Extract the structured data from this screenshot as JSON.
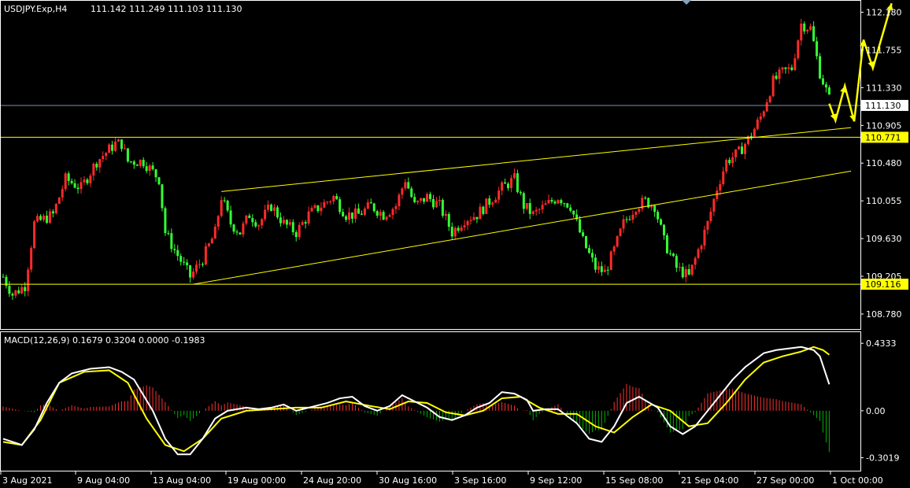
{
  "colors": {
    "background": "#000000",
    "foreground": "#ffffff",
    "bull_candle": "#ff2a2a",
    "bear_candle": "#33ff33",
    "level_line": "#ffff00",
    "price_line": "#7f8fb0",
    "macd_line": "#ffffff",
    "signal_line": "#ffff00",
    "hist_positive": "#ff3030",
    "hist_negative": "#00b000",
    "forecast_arrow": "#ffff00"
  },
  "header": {
    "symbol": "USDJPY.Exp,H4",
    "ohlc": "111.142 111.249 111.103 111.130",
    "collapse_icon": "triangle-down-icon"
  },
  "macd_header": {
    "text": "MACD(12,26,9) 0.1679 0.3204 0.0000 -0.1983"
  },
  "chart_data": [
    {
      "type": "candlestick",
      "title": "USDJPY.Exp,H4",
      "ylim": [
        108.62,
        112.3
      ],
      "yticks": [
        "112.180",
        "111.755",
        "111.330",
        "110.905",
        "110.480",
        "110.055",
        "109.630",
        "109.205",
        "108.780"
      ],
      "price_label": "111.130",
      "current_price": 111.13,
      "horizontal_levels": [
        {
          "value": 110.771,
          "label": "110.771"
        },
        {
          "value": 109.116,
          "label": "109.116"
        }
      ],
      "channel": {
        "upper": {
          "from_bar": 70,
          "from": 110.16,
          "to_bar": 272,
          "to": 110.88
        },
        "lower": {
          "from_bar": 61,
          "from": 109.115,
          "to_bar": 272,
          "to": 110.39
        }
      },
      "xticks": [
        "3 Aug 2021",
        "9 Aug 04:00",
        "13 Aug 04:00",
        "19 Aug 00:00",
        "24 Aug 20:00",
        "30 Aug 16:00",
        "3 Sep 16:00",
        "9 Sep 12:00",
        "15 Sep 08:00",
        "21 Sep 04:00",
        "27 Sep 00:00",
        "1 Oct 00:00"
      ],
      "close_path": [
        [
          0,
          109.2
        ],
        [
          3,
          109.0
        ],
        [
          7,
          109.1
        ],
        [
          10,
          109.8
        ],
        [
          16,
          109.9
        ],
        [
          20,
          110.3
        ],
        [
          25,
          110.2
        ],
        [
          30,
          110.5
        ],
        [
          36,
          110.7
        ],
        [
          38,
          110.7
        ],
        [
          40,
          110.5
        ],
        [
          45,
          110.5
        ],
        [
          50,
          110.3
        ],
        [
          52,
          109.7
        ],
        [
          55,
          109.5
        ],
        [
          60,
          109.2
        ],
        [
          64,
          109.4
        ],
        [
          68,
          109.7
        ],
        [
          70,
          110.1
        ],
        [
          73,
          109.8
        ],
        [
          76,
          109.7
        ],
        [
          79,
          109.9
        ],
        [
          82,
          109.8
        ],
        [
          86,
          110.0
        ],
        [
          90,
          109.8
        ],
        [
          94,
          109.7
        ],
        [
          98,
          109.9
        ],
        [
          102,
          110.0
        ],
        [
          106,
          110.1
        ],
        [
          110,
          109.9
        ],
        [
          114,
          109.9
        ],
        [
          118,
          110.0
        ],
        [
          122,
          109.9
        ],
        [
          126,
          110.0
        ],
        [
          129,
          110.3
        ],
        [
          132,
          110.0
        ],
        [
          136,
          110.1
        ],
        [
          140,
          110.0
        ],
        [
          144,
          109.7
        ],
        [
          148,
          109.85
        ],
        [
          152,
          109.9
        ],
        [
          156,
          110.05
        ],
        [
          160,
          110.2
        ],
        [
          164,
          110.3
        ],
        [
          167,
          110.0
        ],
        [
          170,
          109.9
        ],
        [
          174,
          110.0
        ],
        [
          178,
          110.1
        ],
        [
          182,
          110.0
        ],
        [
          186,
          109.6
        ],
        [
          190,
          109.3
        ],
        [
          193,
          109.25
        ],
        [
          196,
          109.5
        ],
        [
          199,
          109.8
        ],
        [
          203,
          110.0
        ],
        [
          206,
          110.05
        ],
        [
          209,
          110.0
        ],
        [
          212,
          109.6
        ],
        [
          216,
          109.3
        ],
        [
          220,
          109.2
        ],
        [
          223,
          109.5
        ],
        [
          226,
          109.8
        ],
        [
          229,
          110.2
        ],
        [
          232,
          110.5
        ],
        [
          236,
          110.6
        ],
        [
          240,
          110.8
        ],
        [
          243,
          111.0
        ],
        [
          247,
          111.4
        ],
        [
          250,
          111.5
        ],
        [
          253,
          111.55
        ],
        [
          256,
          112.05
        ],
        [
          259,
          112.0
        ],
        [
          262,
          111.5
        ],
        [
          265,
          111.2
        ]
      ],
      "forecast_arrow": [
        [
          265,
          111.15
        ],
        [
          267,
          110.96
        ],
        [
          270,
          111.35
        ],
        [
          273,
          110.95
        ],
        [
          276,
          111.87
        ],
        [
          279,
          111.55
        ],
        [
          285,
          112.28
        ]
      ]
    },
    {
      "type": "line",
      "title": "MACD(12,26,9)",
      "ylim": [
        -0.38,
        0.5
      ],
      "yticks": [
        "0.4333",
        "0.00",
        "-0.3019"
      ],
      "series": [
        {
          "name": "MACD",
          "x": [
            0,
            6,
            10,
            14,
            18,
            22,
            28,
            34,
            38,
            42,
            48,
            52,
            56,
            60,
            64,
            68,
            72,
            78,
            82,
            86,
            90,
            94,
            100,
            104,
            108,
            112,
            116,
            120,
            124,
            128,
            132,
            136,
            140,
            144,
            148,
            152,
            156,
            160,
            164,
            168,
            170,
            174,
            178,
            184,
            188,
            192,
            196,
            200,
            204,
            210,
            214,
            218,
            222,
            226,
            230,
            234,
            238,
            244,
            248,
            252,
            256,
            260,
            262,
            265
          ],
          "values": [
            -0.18,
            -0.22,
            -0.12,
            0.05,
            0.18,
            0.24,
            0.27,
            0.28,
            0.25,
            0.2,
            0.0,
            -0.18,
            -0.28,
            -0.28,
            -0.18,
            -0.05,
            0.0,
            0.02,
            0.01,
            0.02,
            0.04,
            0.0,
            0.03,
            0.05,
            0.08,
            0.09,
            0.03,
            0.0,
            0.03,
            0.1,
            0.06,
            0.02,
            -0.04,
            -0.06,
            -0.03,
            0.02,
            0.05,
            0.12,
            0.11,
            0.07,
            0.0,
            0.01,
            0.01,
            -0.08,
            -0.18,
            -0.2,
            -0.1,
            0.05,
            0.09,
            0.02,
            -0.1,
            -0.15,
            -0.1,
            0.0,
            0.1,
            0.2,
            0.28,
            0.37,
            0.39,
            0.4,
            0.41,
            0.39,
            0.35,
            0.17
          ]
        },
        {
          "name": "Signal",
          "x": [
            0,
            6,
            12,
            18,
            26,
            34,
            40,
            46,
            52,
            58,
            64,
            70,
            78,
            86,
            94,
            102,
            110,
            118,
            124,
            130,
            136,
            142,
            148,
            154,
            160,
            166,
            172,
            178,
            184,
            190,
            196,
            202,
            208,
            214,
            220,
            226,
            232,
            238,
            244,
            250,
            256,
            260,
            263,
            265
          ],
          "values": [
            -0.2,
            -0.22,
            -0.06,
            0.18,
            0.25,
            0.26,
            0.18,
            -0.05,
            -0.22,
            -0.26,
            -0.18,
            -0.05,
            0.0,
            0.01,
            0.02,
            0.02,
            0.06,
            0.03,
            0.01,
            0.06,
            0.05,
            -0.01,
            -0.03,
            0.0,
            0.08,
            0.09,
            0.02,
            -0.02,
            -0.02,
            -0.1,
            -0.14,
            -0.04,
            0.04,
            0.0,
            -0.1,
            -0.08,
            0.05,
            0.2,
            0.31,
            0.35,
            0.38,
            0.41,
            0.39,
            0.36
          ]
        }
      ]
    }
  ]
}
